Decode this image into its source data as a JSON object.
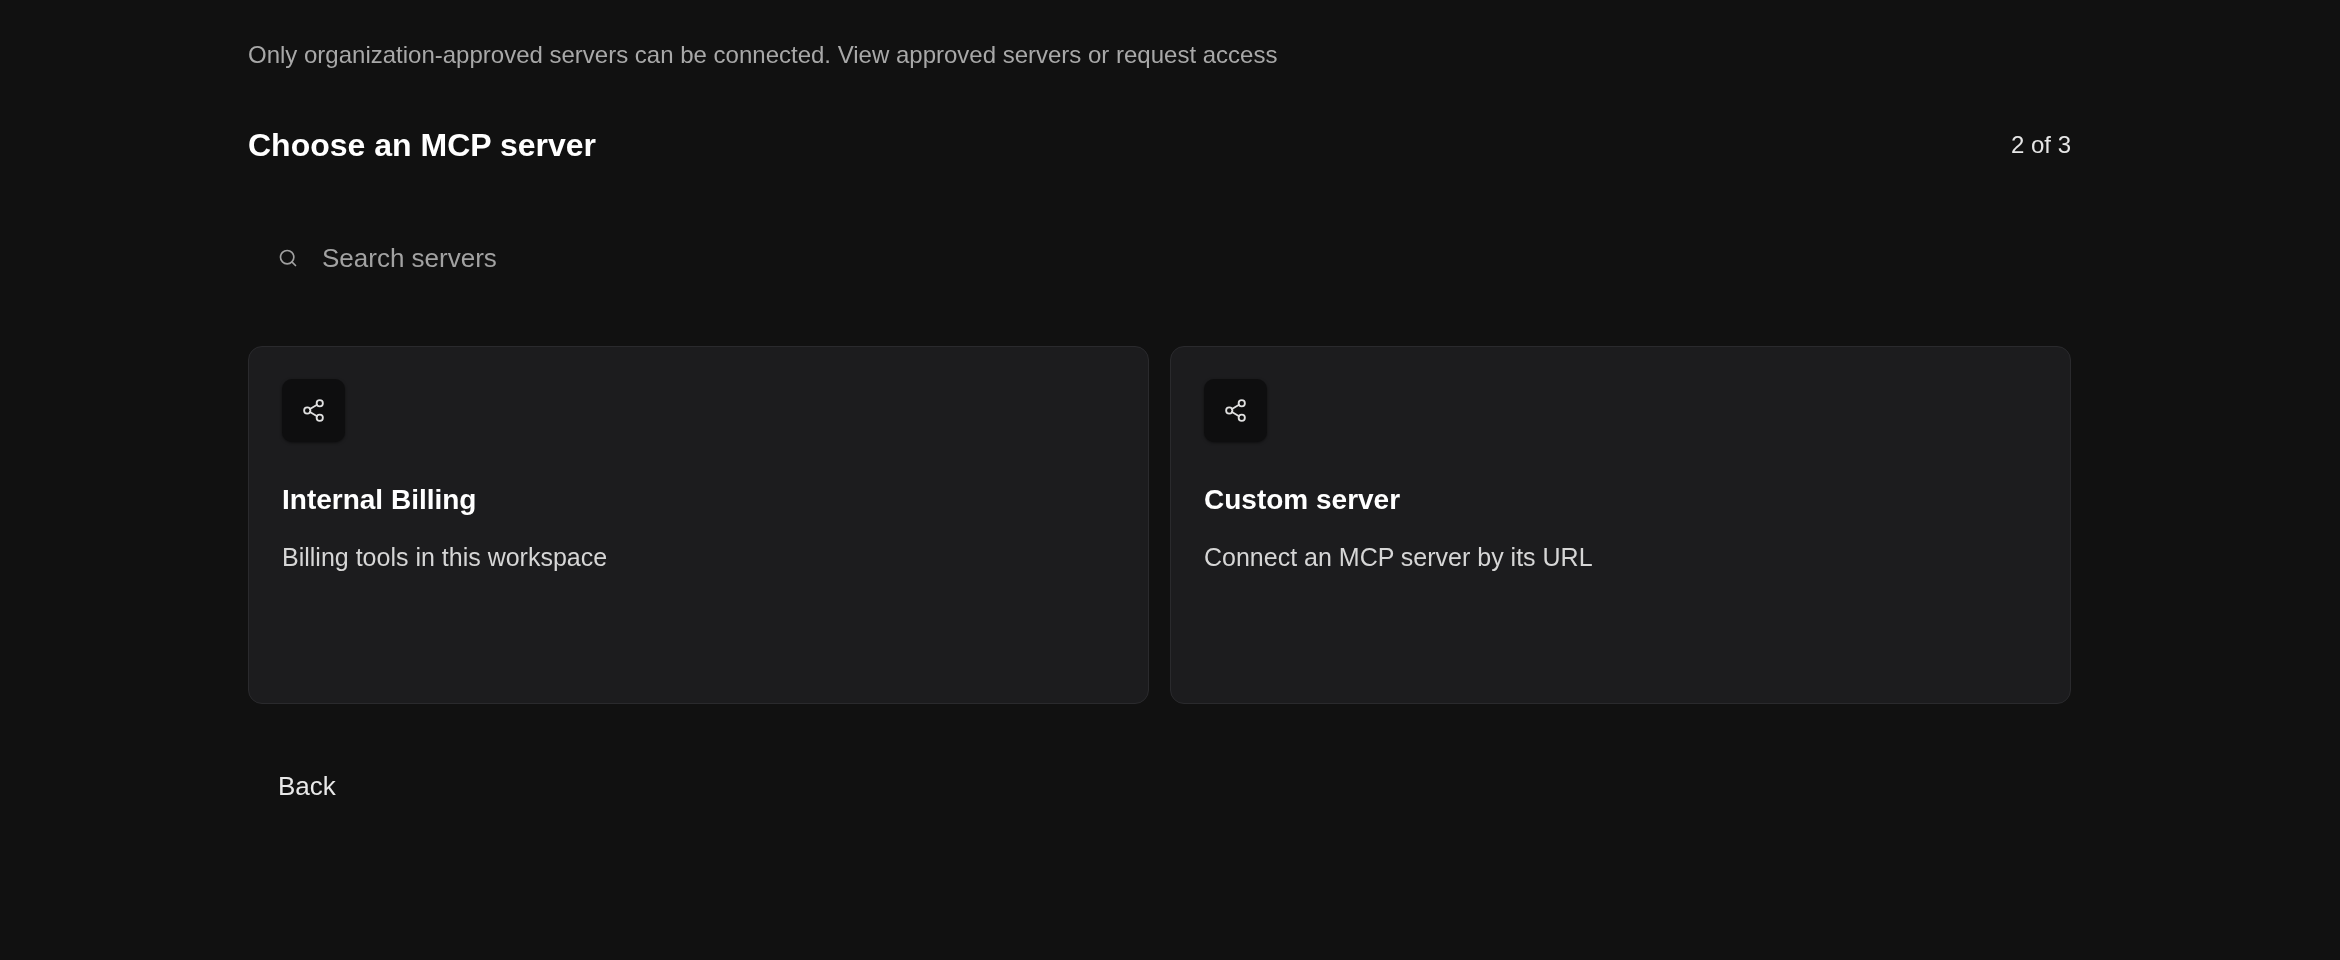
{
  "notice": "Only organization-approved servers can be connected. View approved servers or request access",
  "header": {
    "title": "Choose an MCP server",
    "step": "2 of 3"
  },
  "search": {
    "placeholder": "Search servers"
  },
  "servers": [
    {
      "name": "Internal Billing",
      "description": "Billing tools in this workspace"
    },
    {
      "name": "Custom server",
      "description": "Connect an MCP server by its URL"
    }
  ],
  "buttons": [
    "Back"
  ]
}
